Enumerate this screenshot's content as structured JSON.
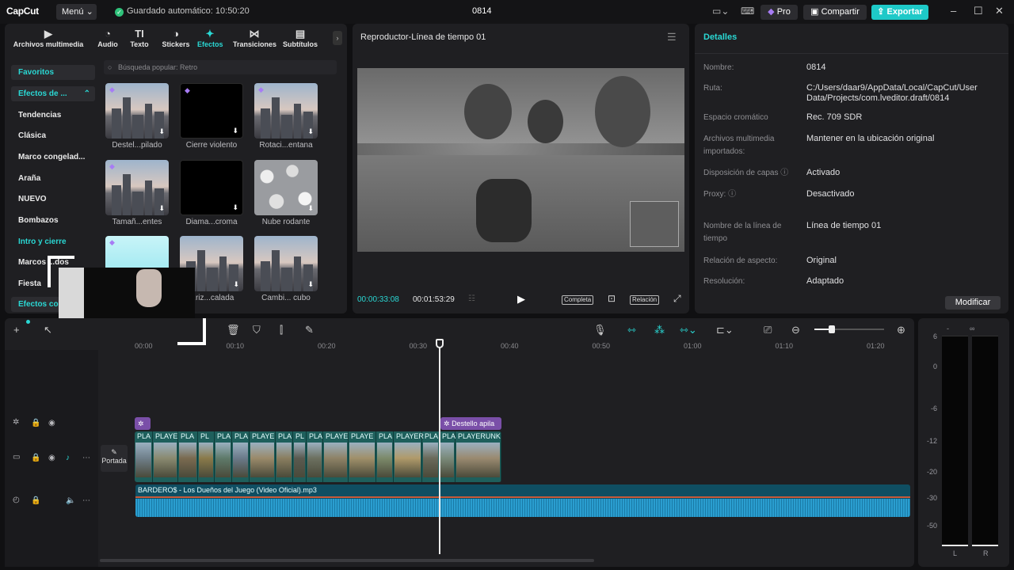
{
  "app": {
    "logo": "CapCut",
    "menu_label": "Menú ⌄",
    "autosave": "Guardado automático: 10:50:20",
    "project_title": "0814",
    "pro_label": "Pro",
    "share_label": "Compartir",
    "export_label": "Exportar"
  },
  "media_tabs": [
    {
      "label": "Archivos multimedia",
      "icon": "media-icon"
    },
    {
      "label": "Audio",
      "icon": "audio-icon"
    },
    {
      "label": "Texto",
      "icon": "text-icon"
    },
    {
      "label": "Stickers",
      "icon": "stickers-icon"
    },
    {
      "label": "Efectos",
      "icon": "effects-icon"
    },
    {
      "label": "Transiciones",
      "icon": "transitions-icon"
    },
    {
      "label": "Subtítulos",
      "icon": "subtitles-icon"
    }
  ],
  "categories": [
    "Favoritos",
    "Efectos de ...",
    "Tendencias",
    "Clásica",
    "Marco congelad...",
    "Araña",
    "NUEVO",
    "Bombazos",
    "Intro y cierre",
    "Marcos ...dos",
    "Fiesta",
    "Efectos co..."
  ],
  "search_placeholder": "Búsqueda popular: Retro",
  "effects": [
    {
      "caption": "Destel...pilado",
      "style": "city",
      "premium": true
    },
    {
      "caption": "Cierre violento",
      "style": "black",
      "premium": true
    },
    {
      "caption": "Rotaci...entana",
      "style": "city",
      "premium": true
    },
    {
      "caption": "Tamañ...entes",
      "style": "city",
      "premium": true
    },
    {
      "caption": "Diama...croma",
      "style": "black",
      "premium": false
    },
    {
      "caption": "Nube rodante",
      "style": "snow",
      "premium": false
    },
    {
      "caption": "",
      "style": "cyan",
      "premium": true
    },
    {
      "caption": "...riz...calada",
      "style": "city",
      "premium": false
    },
    {
      "caption": "Cambi... cubo",
      "style": "city",
      "premium": false
    }
  ],
  "player": {
    "title": "Reproductor-Línea de tiempo 01",
    "current_time": "00:00:33:08",
    "total_time": "00:01:53:29",
    "full_label": "Completa",
    "ratio_label": "Relación"
  },
  "details": {
    "title": "Detalles",
    "rows": [
      {
        "label": "Nombre:",
        "value": "0814"
      },
      {
        "label": "Ruta:",
        "value": "C:/Users/daar9/AppData/Local/CapCut/User Data/Projects/com.lveditor.draft/0814"
      },
      {
        "label": "Espacio cromático",
        "value": "Rec. 709 SDR"
      },
      {
        "label": "Archivos multimedia importados:",
        "value": "Mantener en la ubicación original"
      },
      {
        "label": "Disposición de capas ⓘ",
        "value": "Activado"
      },
      {
        "label": "Proxy: ⓘ",
        "value": "Desactivado"
      },
      {
        "label": "Nombre de la línea de tiempo",
        "value": "Línea de tiempo 01"
      },
      {
        "label": "Relación de aspecto:",
        "value": "Original"
      },
      {
        "label": "Resolución:",
        "value": "Adaptado"
      }
    ],
    "modify_label": "Modificar"
  },
  "timeline": {
    "ticks": [
      "00:00",
      "00:10",
      "00:20",
      "00:30",
      "00:40",
      "00:50",
      "01:00",
      "01:10",
      "01:20"
    ],
    "cover_label": "Portada",
    "effect_clip_label": "Destello apila",
    "video_clips": [
      "PLA",
      "PLAYE",
      "PLA",
      "PL",
      "PLA",
      "PLA",
      "PLAYE",
      "PLA",
      "PL",
      "PLA",
      "PLAYE",
      "PLAYE",
      "PLA",
      "PLAYER",
      "PLA",
      "PLA",
      "PLAYERUNK"
    ],
    "audio_clip_label": "BARDERO$ - Los Dueños del Juego (Video Oficial).mp3"
  },
  "meter": {
    "scale": [
      "-∞",
      "6",
      "0",
      "-6",
      "-12",
      "-20",
      "-30",
      "-50"
    ],
    "left_label": "L",
    "right_label": "R"
  },
  "colors": {
    "accent": "#2ad8d4",
    "export": "#1ec9c8",
    "effect_clip": "#7a4fa8",
    "video_clip": "#1e5f5c",
    "audio_clip": "#0f4e62"
  }
}
